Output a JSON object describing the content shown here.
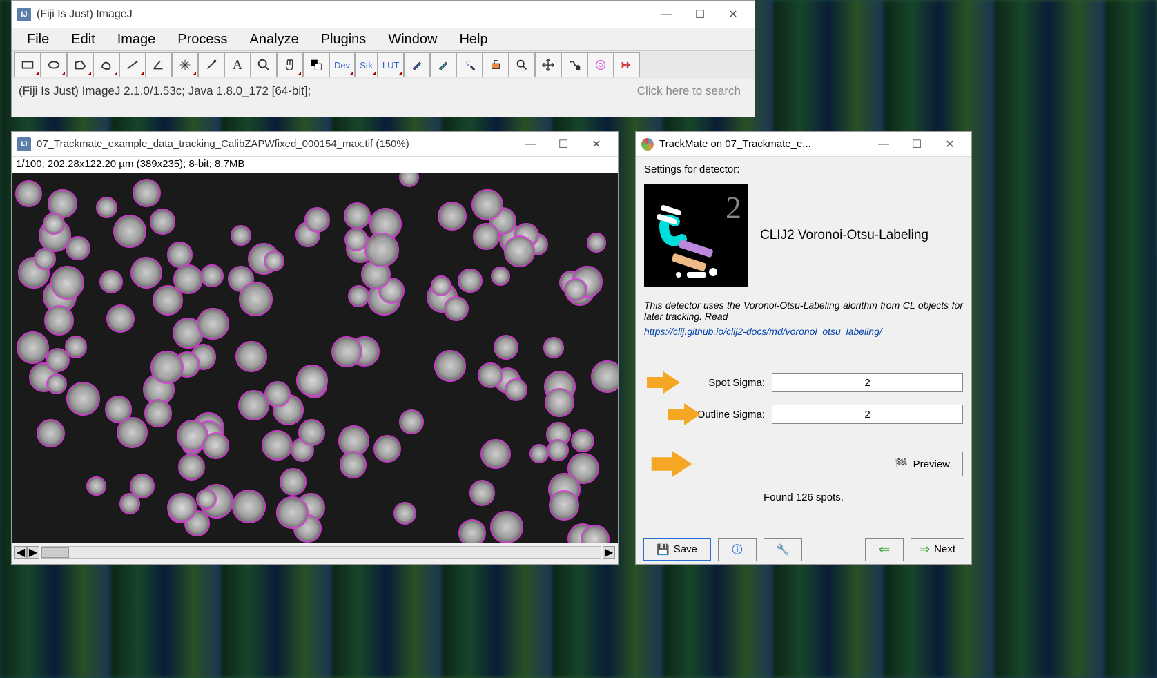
{
  "fiji_main": {
    "title": "(Fiji Is Just) ImageJ",
    "menu": [
      "File",
      "Edit",
      "Image",
      "Process",
      "Analyze",
      "Plugins",
      "Window",
      "Help"
    ],
    "status": "(Fiji Is Just) ImageJ 2.1.0/1.53c; Java 1.8.0_172 [64-bit];",
    "search_hint": "Click here to search",
    "toolbar": [
      {
        "name": "rectangle-tool",
        "glyph": "rect",
        "corner": true
      },
      {
        "name": "oval-tool",
        "glyph": "oval",
        "corner": true
      },
      {
        "name": "polygon-tool",
        "glyph": "poly",
        "corner": true
      },
      {
        "name": "freehand-tool",
        "glyph": "free",
        "corner": true
      },
      {
        "name": "line-tool",
        "glyph": "line",
        "corner": true
      },
      {
        "name": "angle-tool",
        "glyph": "angle",
        "corner": false
      },
      {
        "name": "point-tool",
        "glyph": "point",
        "corner": true
      },
      {
        "name": "wand-tool",
        "glyph": "wand",
        "corner": false
      },
      {
        "name": "text-tool",
        "glyph": "A",
        "corner": false
      },
      {
        "name": "zoom-tool",
        "glyph": "zoom",
        "corner": false
      },
      {
        "name": "hand-tool",
        "glyph": "hand",
        "corner": true
      },
      {
        "name": "color-picker-tool",
        "glyph": "color",
        "corner": false
      },
      {
        "name": "dev-tool",
        "glyph": "Dev",
        "corner": true,
        "wide": true
      },
      {
        "name": "stk-tool",
        "glyph": "Stk",
        "corner": true,
        "wide": true
      },
      {
        "name": "lut-tool",
        "glyph": "LUT",
        "corner": true,
        "wide": true
      },
      {
        "name": "brush1-tool",
        "glyph": "brush",
        "corner": false
      },
      {
        "name": "brush2-tool",
        "glyph": "brush2",
        "corner": false
      },
      {
        "name": "spray-tool",
        "glyph": "spray",
        "corner": false
      },
      {
        "name": "paint-tool",
        "glyph": "paint",
        "corner": false
      },
      {
        "name": "find-tool",
        "glyph": "find",
        "corner": false
      },
      {
        "name": "move-tool",
        "glyph": "move",
        "corner": false
      },
      {
        "name": "script-tool",
        "glyph": "script",
        "corner": false
      },
      {
        "name": "annotate-tool",
        "glyph": "ann",
        "corner": false
      },
      {
        "name": "more-tool",
        "glyph": "more",
        "corner": false
      }
    ]
  },
  "image_window": {
    "title": "07_Trackmate_example_data_tracking_CalibZAPWfixed_000154_max.tif (150%)",
    "meta": "1/100; 202.28x122.20 µm (389x235); 8-bit; 8.7MB"
  },
  "trackmate_window": {
    "title": "TrackMate on 07_Trackmate_e...",
    "heading": "Settings for detector:",
    "detector_name": "CLIJ2 Voronoi-Otsu-Labeling",
    "description": "This detector uses the Voronoi-Otsu-Labeling alorithm from CL objects for later tracking. Read",
    "link": "https://clij.github.io/clij2-docs/md/voronoi_otsu_labeling/",
    "spot_sigma_label": "Spot Sigma:",
    "spot_sigma_value": "2",
    "outline_sigma_label": "Outline Sigma:",
    "outline_sigma_value": "2",
    "preview_label": "Preview",
    "found_text": "Found 126 spots.",
    "save_label": "Save",
    "next_label": "Next"
  }
}
